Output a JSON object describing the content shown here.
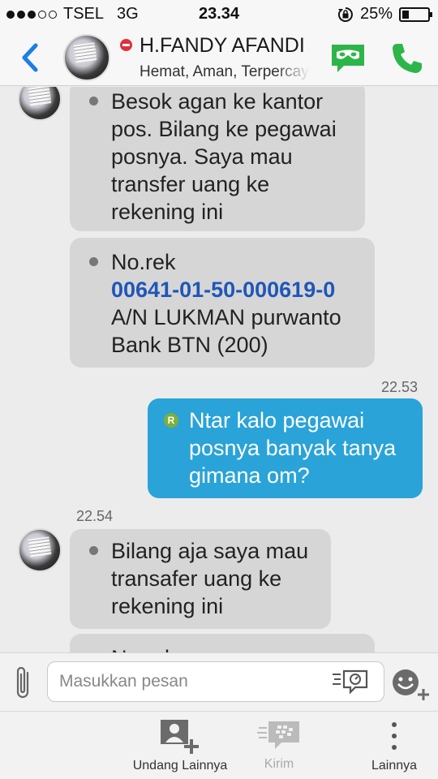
{
  "status_bar": {
    "carrier": "TSEL",
    "network": "3G",
    "time": "23.34",
    "battery_percent": "25%",
    "battery_level": 0.25,
    "signal_bars": 3,
    "signal_max": 5
  },
  "header": {
    "contact_name": "H.FANDY AFANDI",
    "contact_status": "Hemat, Aman, Terpercaya",
    "back_icon": "chevron-left-icon",
    "video_icon": "video-chat-icon",
    "call_icon": "phone-icon"
  },
  "messages": [
    {
      "direction": "in",
      "lines": [
        "Besok agan ke kantor",
        "pos. Bilang ke pegawai",
        "posnya. Saya mau",
        "transfer uang ke",
        "rekening ini"
      ]
    },
    {
      "direction": "in",
      "line1": "No.rek",
      "account_number": "00641-01-50-000619-0",
      "line3": "A/N LUKMAN purwanto",
      "line4": "Bank BTN (200)"
    },
    {
      "direction": "out",
      "time": "22.53",
      "badge": "R",
      "lines": [
        "Ntar kalo pegawai",
        "posnya banyak tanya",
        "gimana om?"
      ]
    },
    {
      "direction": "in",
      "time": "22.54",
      "lines": [
        "Bilang aja saya mau",
        "transafer uang ke",
        "rekening ini"
      ]
    },
    {
      "direction": "in",
      "lines": [
        "No.rek"
      ]
    }
  ],
  "composer": {
    "placeholder": "Masukkan pesan"
  },
  "bottom_bar": {
    "tabs": [
      {
        "label": "Undang Lainnya",
        "icon": "add-contact-icon",
        "enabled": true
      },
      {
        "label": "Kirim",
        "icon": "send-bbm-icon",
        "enabled": false
      },
      {
        "label": "Lainnya",
        "icon": "more-vertical-icon",
        "enabled": true
      }
    ]
  },
  "colors": {
    "outgoing_bubble": "#2aa3d8",
    "incoming_bubble": "#d6d6d6",
    "accent_green": "#2db54a",
    "link_blue": "#1f56b8",
    "back_blue": "#1a7ee6"
  }
}
